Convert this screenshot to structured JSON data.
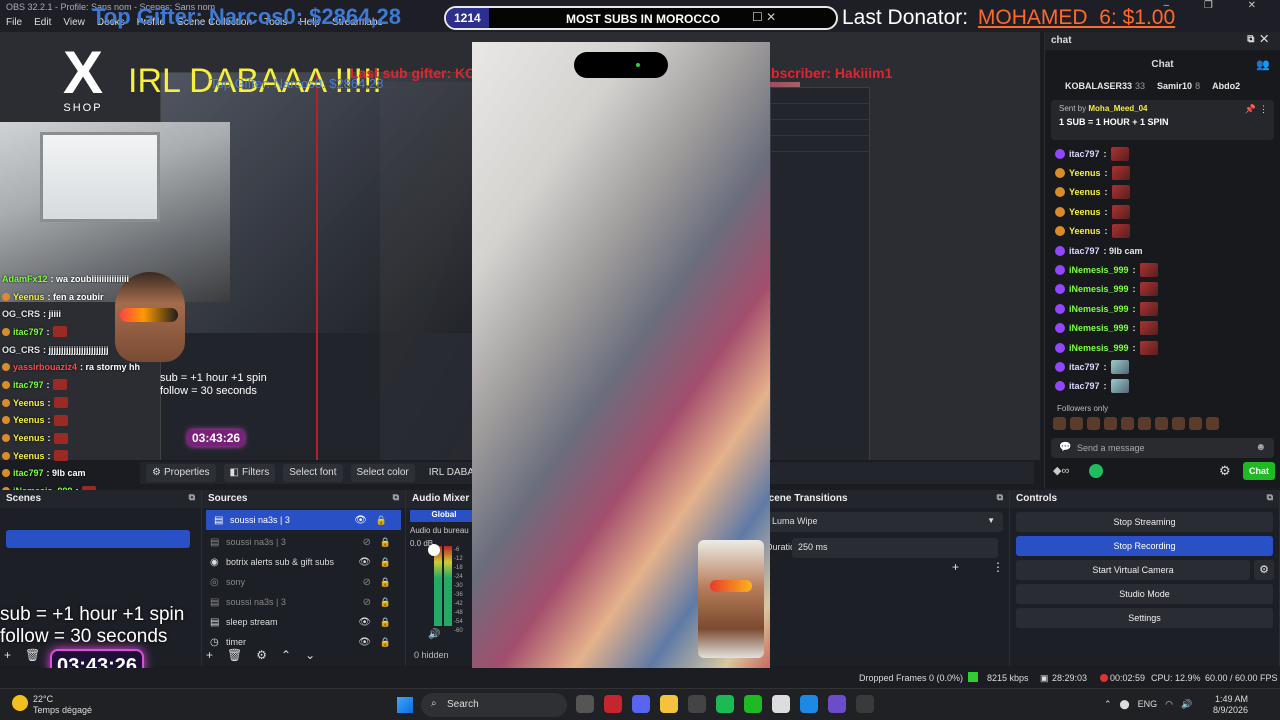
{
  "window": {
    "title": "OBS 32.2.1 - Profile: Sans nom - Scenes: Sans nom",
    "controls": "–  ❐  ✕"
  },
  "menu": [
    "File",
    "Edit",
    "View",
    "Docks",
    "Profile",
    "Scene Collection",
    "Tools",
    "Help",
    "Streamlabs"
  ],
  "overlay": {
    "top_gifter": "Top Gifter: Narcos0: $2864,28",
    "goal_count": "1214",
    "goal_label": "MOST SUBS IN MOROCCO",
    "goal_close": "☐  ✕",
    "goal_progress": 0.11,
    "last_donator_label": "Last Donator:",
    "last_donator_value": "MOHAMED_6: $1.00",
    "last_sub_gifter": "Last sub gifter: KOBALASER33",
    "last_subscriber": "Last subscriber: Hakiiim1",
    "nested_top_gifter": "Top Gifter: Narcos0: $2864,28",
    "big_text": "IRL DABAAA !!!!!",
    "logo_x": "X",
    "logo_shop": "SHOP",
    "rules_line1": "sub  = +1 hour +1 spin",
    "rules_line2": "follow = 30 seconds",
    "timer": "03:43:26",
    "nested_rules_1": "sub  = +1 hour +1 spin",
    "nested_rules_2": "follow = 30 seconds",
    "nested_timer": "03:43:26"
  },
  "left_chat": [
    {
      "name": "AdamFx12",
      "text": ": wa zoubiiiiiiiiiiiiiii",
      "color": "g"
    },
    {
      "name": "Yeenus",
      "text": ": fen a zoubir",
      "color": "y",
      "badge": true
    },
    {
      "name": "OG_CRS",
      "text": ": jiiii",
      "color": "w"
    },
    {
      "name": "itac797",
      "text": ":",
      "color": "g",
      "badge": true,
      "emote": true
    },
    {
      "name": "OG_CRS",
      "text": ": jjjjjjjjjjjjjjjjjjjjjjjj",
      "color": "w"
    },
    {
      "name": "yassirbouaziz4",
      "text": ": ra stormy hh",
      "color": "r",
      "badge": true
    },
    {
      "name": "itac797",
      "text": ":",
      "color": "g",
      "badge": true,
      "emote": true
    },
    {
      "name": "Yeenus",
      "text": ":",
      "color": "y",
      "badge": true,
      "emote": true
    },
    {
      "name": "Yeenus",
      "text": ":",
      "color": "y",
      "badge": true,
      "emote": true
    },
    {
      "name": "Yeenus",
      "text": ":",
      "color": "y",
      "badge": true,
      "emote": true
    },
    {
      "name": "Yeenus",
      "text": ":",
      "color": "y",
      "badge": true,
      "emote": true
    },
    {
      "name": "itac797",
      "text": ": 9lb cam",
      "color": "g",
      "badge": true
    },
    {
      "name": "iNemesis_999",
      "text": ":",
      "color": "g",
      "badge": true,
      "emote": true
    },
    {
      "name": "iNemesis_999",
      "text": ":",
      "color": "g",
      "badge": true,
      "emote": true
    },
    {
      "name": "iNemesis_999",
      "text": ":",
      "color": "g",
      "badge": true,
      "emote": true
    },
    {
      "name": "iNemesis_999",
      "text": ":",
      "color": "g",
      "badge": true,
      "emote": true
    },
    {
      "name": "iNemesis_999",
      "text": ":",
      "color": "g",
      "badge": true,
      "emote": true
    },
    {
      "name": "itac797",
      "text": ":",
      "color": "g",
      "badge": true,
      "emote": true
    },
    {
      "name": "itac797",
      "text": ":",
      "color": "g",
      "badge": true,
      "emote": true
    }
  ],
  "toolbar": {
    "properties": "Properties",
    "filters": "Filters",
    "select_font": "Select font",
    "select_color": "Select color",
    "source_name": "IRL DABAAA !!!!!"
  },
  "scenes": {
    "title": "Scenes"
  },
  "sources": {
    "title": "Sources",
    "items": [
      {
        "name": "soussi na3s | 3",
        "active": true,
        "dim": false,
        "icon": "▤"
      },
      {
        "name": "soussi na3s | 3",
        "active": false,
        "dim": true,
        "icon": "▤"
      },
      {
        "name": "botrix alerts sub & gift subs",
        "active": false,
        "dim": false,
        "icon": "◉"
      },
      {
        "name": "sony",
        "active": false,
        "dim": true,
        "icon": "◎"
      },
      {
        "name": "soussi na3s | 3",
        "active": false,
        "dim": true,
        "icon": "▤"
      },
      {
        "name": "sleep stream",
        "active": false,
        "dim": false,
        "icon": "▤"
      },
      {
        "name": "timer",
        "active": false,
        "dim": false,
        "icon": "◷"
      }
    ]
  },
  "mixer": {
    "title": "Audio Mixer",
    "global": "Global",
    "channel": "Audio du bureau",
    "level": "0.0 dB",
    "scale": [
      "-6",
      "-12",
      "-18",
      "-24",
      "-30",
      "-36",
      "-42",
      "-48",
      "-54",
      "-60"
    ],
    "hidden": "0 hidden"
  },
  "transitions": {
    "title": "Scene Transitions",
    "type": "Luma Wipe",
    "duration_label": "Duration",
    "duration": "250 ms"
  },
  "controls": {
    "title": "Controls",
    "stop_streaming": "Stop Streaming",
    "stop_recording": "Stop Recording",
    "virtual_camera": "Start Virtual Camera",
    "studio_mode": "Studio Mode",
    "settings": "Settings"
  },
  "chat": {
    "dock_title": "chat",
    "header": "Chat",
    "gifters": [
      {
        "name": "KOBALASER33",
        "count": "33"
      },
      {
        "name": "Samir10",
        "count": "8"
      },
      {
        "name": "Abdo2",
        "count": ""
      }
    ],
    "pinned_by": "Sent by",
    "pinned_user": "Moha_Meed_04",
    "pinned_msg": "1 SUB = 1 HOUR + 1 SPIN",
    "messages": [
      {
        "name": "itac797",
        "text": ":",
        "emote": true,
        "sub": true,
        "color": "#d8d8ff"
      },
      {
        "name": "Yeenus",
        "text": ":",
        "emote": true,
        "sub": false,
        "color": "#f6ef3c"
      },
      {
        "name": "Yeenus",
        "text": ":",
        "emote": true,
        "sub": false,
        "color": "#f6ef3c"
      },
      {
        "name": "Yeenus",
        "text": ":",
        "emote": true,
        "sub": false,
        "color": "#f6ef3c"
      },
      {
        "name": "Yeenus",
        "text": ":",
        "emote": true,
        "sub": false,
        "color": "#f6ef3c"
      },
      {
        "name": "itac797",
        "text": ": 9lb cam",
        "emote": false,
        "sub": true,
        "color": "#d8d8ff"
      },
      {
        "name": "iNemesis_999",
        "text": ":",
        "emote": true,
        "sub": true,
        "color": "#7aff3b"
      },
      {
        "name": "iNemesis_999",
        "text": ":",
        "emote": true,
        "sub": true,
        "color": "#7aff3b"
      },
      {
        "name": "iNemesis_999",
        "text": ":",
        "emote": true,
        "sub": true,
        "color": "#7aff3b"
      },
      {
        "name": "iNemesis_999",
        "text": ":",
        "emote": true,
        "sub": true,
        "color": "#7aff3b"
      },
      {
        "name": "iNemesis_999",
        "text": ":",
        "emote": true,
        "sub": true,
        "color": "#7aff3b"
      },
      {
        "name": "itac797",
        "text": ":",
        "emote": true,
        "sub": true,
        "color": "#d8d8ff"
      },
      {
        "name": "itac797",
        "text": ":",
        "emote": true,
        "sub": true,
        "color": "#d8d8ff"
      }
    ],
    "followers_only": "Followers only",
    "placeholder": "Send a message",
    "chat_button": "Chat"
  },
  "status": {
    "dropped_frames": "Dropped Frames 0 (0.0%)",
    "bitrate": "8215 kbps",
    "stream_time": "28:29:03",
    "rec_time": "00:02:59",
    "cpu": "CPU: 12.9%",
    "fps": "60.00 / 60.00 FPS"
  },
  "taskbar": {
    "temp": "22°C",
    "weather": "Temps dégagé",
    "search": "Search",
    "lang": "ENG",
    "time": "1:49 AM",
    "date": "8/9/2026"
  },
  "colors": {
    "accent": "#2a50c6",
    "overlay_yellow": "#f6ef3c",
    "gifter_blue": "#3d7ad6",
    "donator_orange": "#ff6a2a",
    "chat_green": "#1fb923",
    "timer_glow": "#e14be0"
  }
}
